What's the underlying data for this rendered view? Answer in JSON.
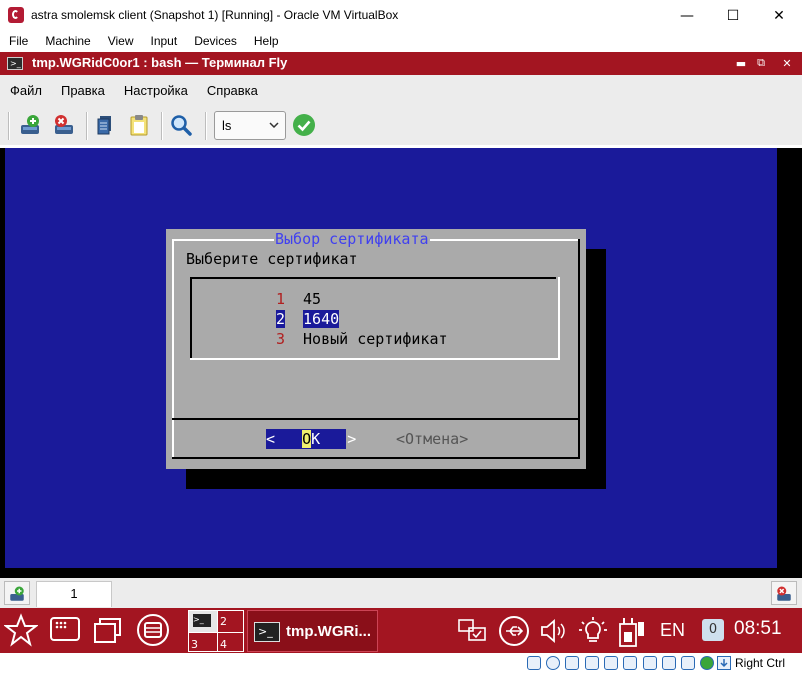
{
  "vbox": {
    "title": "astra smolemsk client (Snapshot 1) [Running] - Oracle VM VirtualBox",
    "menu": [
      "File",
      "Machine",
      "View",
      "Input",
      "Devices",
      "Help"
    ],
    "host_key": "Right Ctrl"
  },
  "fly": {
    "title": "tmp.WGRidC0or1 : bash — Терминал Fly",
    "menu": [
      "Файл",
      "Правка",
      "Настройка",
      "Справка"
    ],
    "command_select": "ls"
  },
  "dialog": {
    "title": "Выбор сертификата",
    "prompt": "Выберите сертификат",
    "items": [
      {
        "num": "1",
        "label": "45"
      },
      {
        "num": "2",
        "label": "1640"
      },
      {
        "num": "3",
        "label": "Новый сертификат"
      }
    ],
    "selected_index": 1,
    "ok": {
      "left": "<",
      "hot": "O",
      "rest": "K",
      "right": ">"
    },
    "cancel": "<Отмена>"
  },
  "tabs": {
    "current": "1"
  },
  "taskbar": {
    "desktops": [
      "2",
      "3",
      "4"
    ],
    "window_title": "tmp.WGRi...",
    "lang": "EN",
    "notifications": "0",
    "clock": "08:51"
  },
  "colors": {
    "accent": "#a31521",
    "terminal_bg": "#1a1a9a",
    "dialog_bg": "#aaaaaa",
    "dialog_title": "#4040f0",
    "hotkey": "#b02020",
    "highlight_bg": "#1a1a9a",
    "hot_letter_bg": "#f0f070"
  }
}
